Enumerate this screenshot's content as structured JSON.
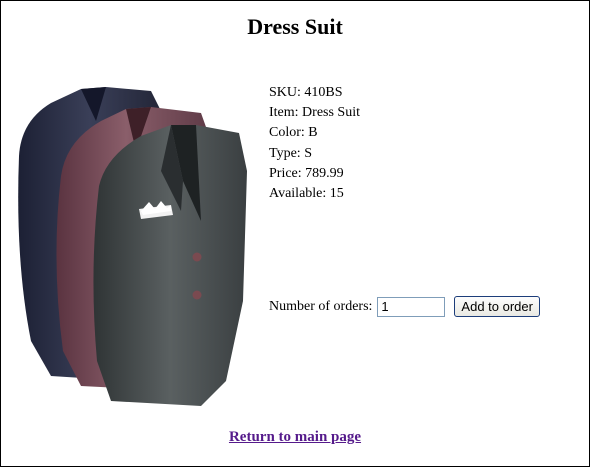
{
  "page": {
    "title": "Dress Suit"
  },
  "product": {
    "image_icon": "suit-jackets-image",
    "details": [
      {
        "label": "SKU:",
        "value": "410BS"
      },
      {
        "label": "Item:",
        "value": "Dress Suit"
      },
      {
        "label": "Color:",
        "value": "B"
      },
      {
        "label": "Type:",
        "value": "S"
      },
      {
        "label": "Price:",
        "value": "789.99"
      },
      {
        "label": "Available:",
        "value": "15"
      }
    ]
  },
  "order": {
    "label": "Number of orders:",
    "quantity_value": "1",
    "add_button_label": "Add to order"
  },
  "nav": {
    "return_link_text": "Return to main page"
  },
  "colors": {
    "link_visited": "#551a8b",
    "jacket_navy": "#2a2f45",
    "jacket_burgundy": "#6b4550",
    "jacket_charcoal": "#3c4142"
  }
}
